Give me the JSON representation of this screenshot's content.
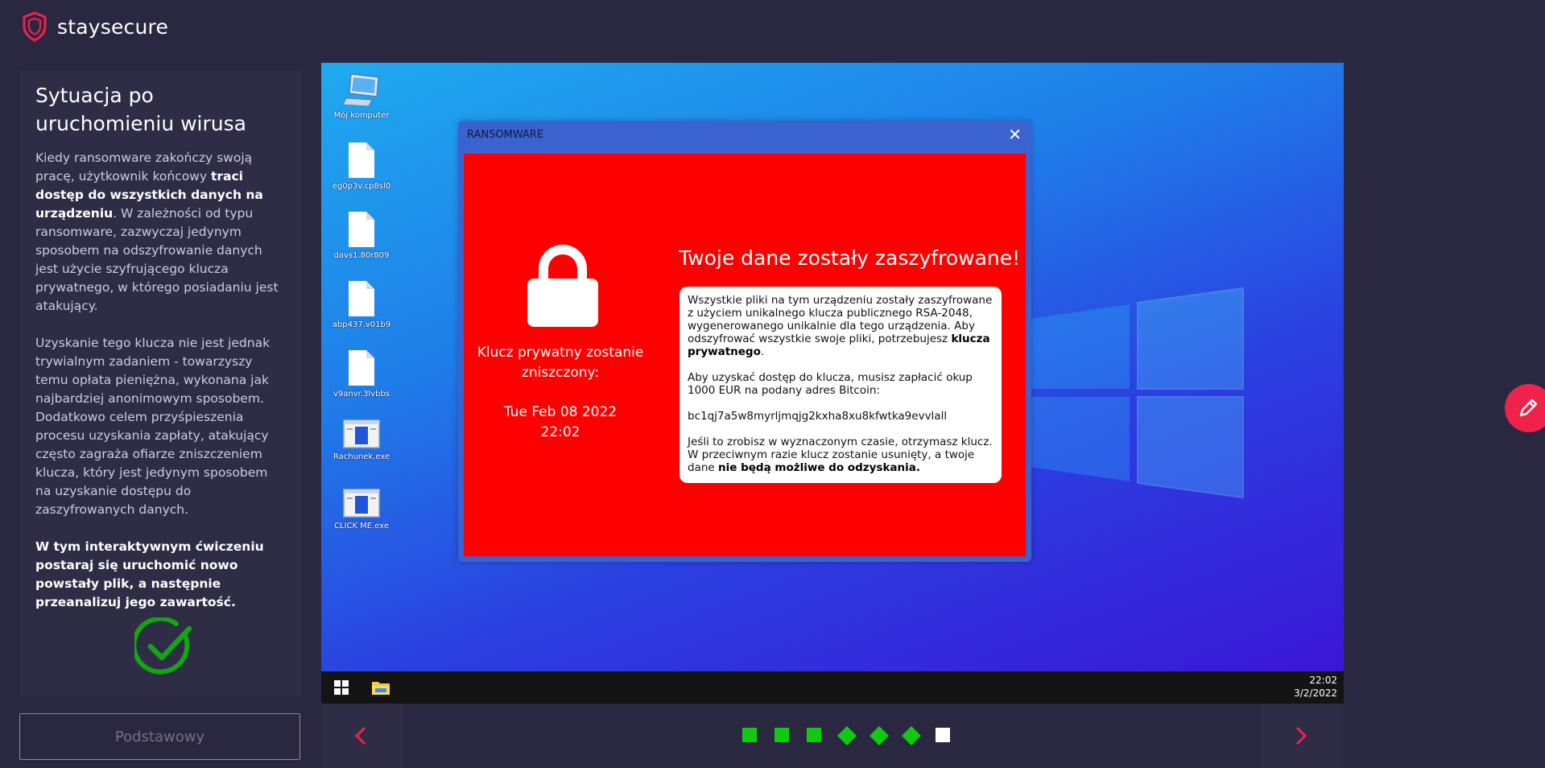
{
  "brand": {
    "name": "staysecure"
  },
  "left_panel": {
    "title": "Sytuacja po uruchomieniu wirusa",
    "p1_a": "Kiedy ransomware zakończy swoją pracę, użytkownik końcowy ",
    "p1_b": "traci dostęp do wszystkich danych na urządzeniu",
    "p1_c": ". W zależności od typu ransomware, zazwyczaj jedynym sposobem na odszyfrowanie danych jest użycie szyfrującego klucza prywatnego, w którego posiadaniu jest atakujący.",
    "p2": "Uzyskanie tego klucza nie jest jednak trywialnym zadaniem - towarzyszy temu opłata pieniężna, wykonana jak najbardziej anonimowym sposobem. Dodatkowo celem przyśpieszenia procesu uzyskania zapłaty, atakujący często zagraża ofiarze zniszczeniem klucza, który jest jedynym sposobem na uzyskanie dostępu do zaszyfrowanych danych.",
    "p3": "W tym interaktywnym ćwiczeniu postaraj się uruchomić nowo powstały plik, a następnie przeanalizuj jego zawartość.",
    "status_icon": "check-circle-icon"
  },
  "level_button": {
    "label": "Podstawowy"
  },
  "desktop": {
    "icons": [
      {
        "label": "Mój komputer",
        "icon": "computer-icon"
      },
      {
        "label": "eg0p3v.cp8sl0",
        "icon": "file-icon"
      },
      {
        "label": "davs1.80r809",
        "icon": "file-icon"
      },
      {
        "label": "abp437.v01b9",
        "icon": "file-icon"
      },
      {
        "label": "v9anvr.3lvbbs",
        "icon": "file-icon"
      },
      {
        "label": "Rachunek.exe",
        "icon": "exe-icon"
      },
      {
        "label": "CLICK ME.exe",
        "icon": "exe-icon"
      }
    ]
  },
  "ransom_window": {
    "title": "RANSOMWARE",
    "close": "✕",
    "key_destroy_label": "Klucz prywatny zostanie zniszczony:",
    "date_line1": "Tue Feb 08 2022",
    "date_line2": "22:02",
    "heading": "Twoje dane zostały zaszyfrowane!",
    "msg1_a": "Wszystkie pliki na tym urządzeniu zostały zaszyfrowane z użyciem unikalnego klucza publicznego RSA-2048, wygenerowanego unikalnie dla tego urządzenia. Aby odszyfrować wszystkie swoje pliki, potrzebujesz ",
    "msg1_b": "klucza prywatnego",
    "msg1_c": ".",
    "msg2": "Aby uzyskać dostęp do klucza, musisz zapłacić okup 1000 EUR na podany adres Bitcoin:",
    "bitcoin_address": "bc1qj7a5w8myrljmqjg2kxha8xu8kfwtka9evvlall",
    "msg3_a": "Jeśli to zrobisz w wyznaczonym czasie, otrzymasz klucz. W przeciwnym razie klucz zostanie usunięty, a twoje dane ",
    "msg3_b": "nie będą możliwe do odzyskania."
  },
  "taskbar": {
    "time": "22:02",
    "date": "3/2/2022"
  },
  "progress": {
    "steps": [
      {
        "shape": "square",
        "state": "done"
      },
      {
        "shape": "square",
        "state": "done"
      },
      {
        "shape": "square",
        "state": "done"
      },
      {
        "shape": "diamond",
        "state": "done"
      },
      {
        "shape": "diamond",
        "state": "done"
      },
      {
        "shape": "diamond",
        "state": "done"
      },
      {
        "shape": "square",
        "state": "current"
      }
    ],
    "colors": {
      "done": "#12c912",
      "current": "#ffffff"
    }
  },
  "colors": {
    "accent": "#f0224c",
    "ransom_red": "#ff0000",
    "check_green": "#14a414"
  }
}
